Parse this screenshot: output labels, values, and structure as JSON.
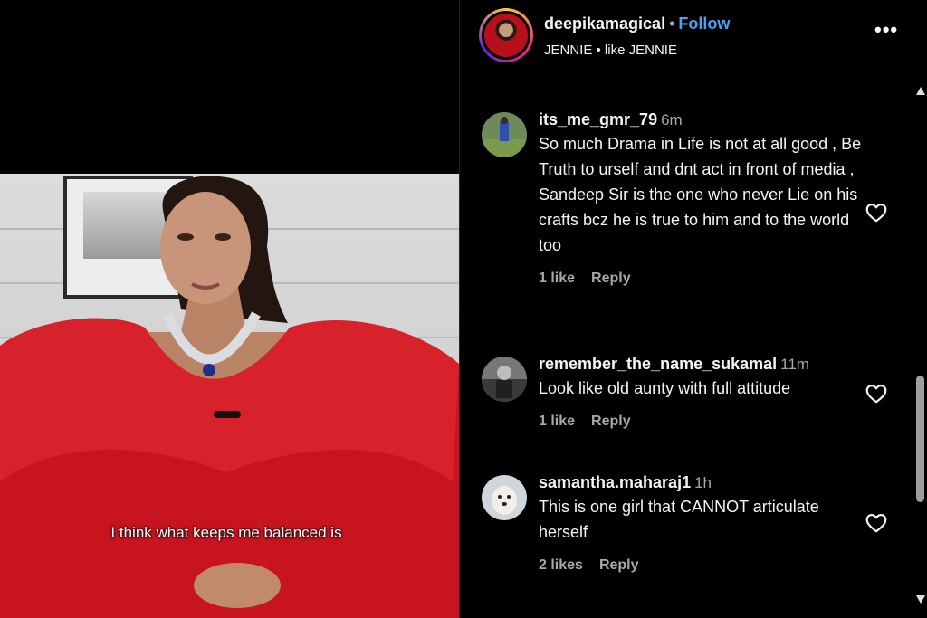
{
  "post": {
    "username": "deepikamagical",
    "separator": "•",
    "follow_label": "Follow",
    "audio_line": "JENNIE • like JENNIE",
    "more_label": "•••"
  },
  "video": {
    "subtitle": "I think what keeps me balanced is"
  },
  "comments": [
    {
      "username": "its_me_gmr_79",
      "time": "6m",
      "text": "So much Drama in Life is not at all good , Be Truth to urself and dnt act in front of media , Sandeep Sir is the one who never Lie on his crafts bcz he is true to him and to the world too",
      "likes": "1 like",
      "reply": "Reply"
    },
    {
      "username": "remember_the_name_sukamal",
      "time": "11m",
      "text": "Look like old aunty with full attitude",
      "likes": "1 like",
      "reply": "Reply"
    },
    {
      "username": "samantha.maharaj1",
      "time": "1h",
      "text": "This is one girl that CANNOT articulate herself",
      "likes": "2 likes",
      "reply": "Reply"
    }
  ],
  "icons": {
    "heart": "heart-icon",
    "more": "more-options-icon",
    "scroll_up": "scroll-up-icon",
    "scroll_down": "scroll-down-icon"
  },
  "colors": {
    "background": "#000000",
    "follow": "#4aa3f0",
    "muted_text": "#a8a8a8",
    "dress": "#c8141e"
  }
}
